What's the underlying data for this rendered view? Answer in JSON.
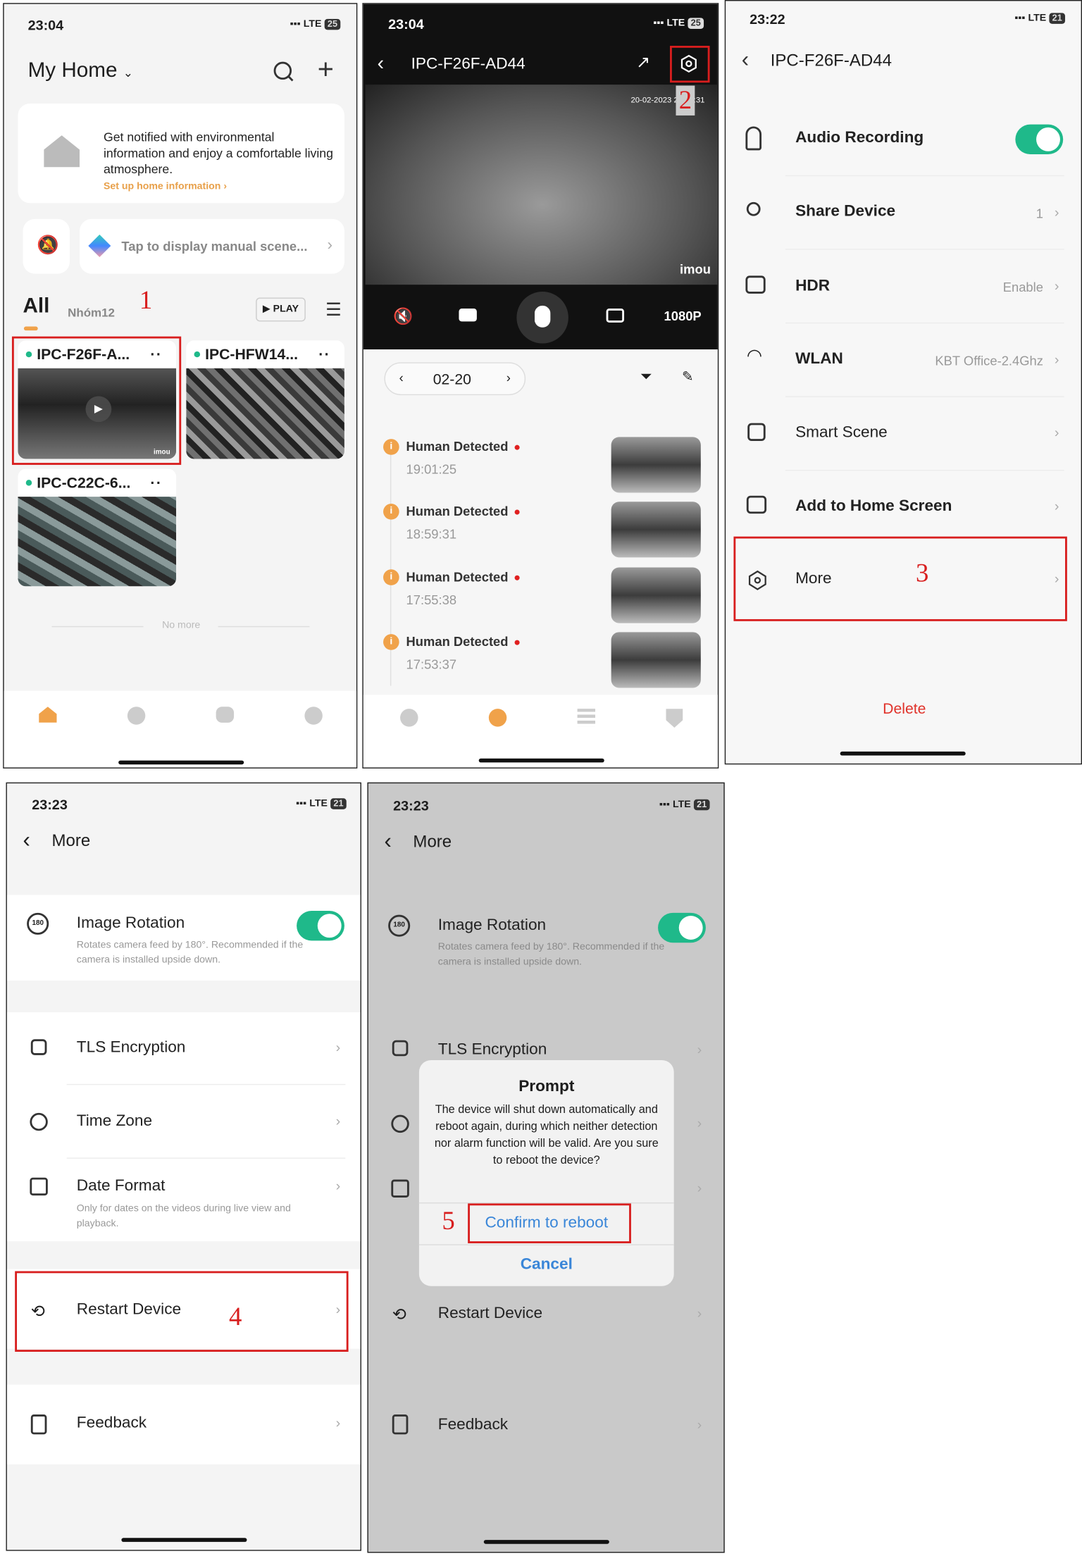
{
  "screen1": {
    "time": "23:04",
    "network": "LTE",
    "battery": "25",
    "title": "My Home",
    "banner": {
      "text": "Get notified with environmental information and enjoy a comfortable living atmosphere.",
      "link": "Set up home information"
    },
    "scene": "Tap to display manual scene...",
    "tabs": [
      "All",
      "Nhóm12"
    ],
    "play": "PLAY",
    "step": "1",
    "devices": [
      "IPC-F26F-A...",
      "IPC-HFW14...",
      "IPC-C22C-6..."
    ],
    "no_more": "No more",
    "thumb_brand": "imou"
  },
  "screen2": {
    "time": "23:04",
    "network": "LTE",
    "battery": "25",
    "title": "IPC-F26F-AD44",
    "timestamp": "20-02-2023 23:04:31",
    "brand": "imou",
    "step": "2",
    "resolution": "1080P",
    "date": "02-20",
    "events": [
      {
        "title": "Human Detected",
        "time": "19:01:25"
      },
      {
        "title": "Human Detected",
        "time": "18:59:31"
      },
      {
        "title": "Human Detected",
        "time": "17:55:38"
      },
      {
        "title": "Human Detected",
        "time": "17:53:37"
      }
    ]
  },
  "screen3": {
    "time": "23:22",
    "network": "LTE",
    "battery": "21",
    "title": "IPC-F26F-AD44",
    "step": "3",
    "rows": [
      {
        "label": "Audio Recording",
        "toggle": true
      },
      {
        "label": "Share Device",
        "value": "1"
      },
      {
        "label": "HDR",
        "value": "Enable"
      },
      {
        "label": "WLAN",
        "value": "KBT Office-2.4Ghz"
      },
      {
        "label": "Smart Scene"
      },
      {
        "label": "Add to Home Screen"
      },
      {
        "label": "More"
      }
    ],
    "delete": "Delete"
  },
  "screen4": {
    "time": "23:23",
    "network": "LTE",
    "battery": "21",
    "title": "More",
    "step": "4",
    "rotation": {
      "label": "Image Rotation",
      "desc": "Rotates camera feed by 180°. Recommended if the camera is installed upside down.",
      "on": true
    },
    "tls": "TLS Encryption",
    "timezone": "Time Zone",
    "date_format": {
      "label": "Date Format",
      "desc": "Only for dates on the videos during live view and playback."
    },
    "restart": "Restart Device",
    "feedback": "Feedback"
  },
  "screen5": {
    "time": "23:23",
    "network": "LTE",
    "battery": "21",
    "title": "More",
    "step": "5",
    "dialog": {
      "title": "Prompt",
      "message": "The device will shut down automatically and reboot again, during which neither detection nor alarm function will be valid. Are you sure to reboot the device?",
      "confirm": "Confirm to reboot",
      "cancel": "Cancel"
    }
  },
  "colors": {
    "accent_orange": "#f0a24a",
    "toggle_green": "#1fb98a",
    "delete_red": "#e0322a",
    "dialog_blue": "#3a86d8",
    "annotation_red": "#d81e1e"
  }
}
